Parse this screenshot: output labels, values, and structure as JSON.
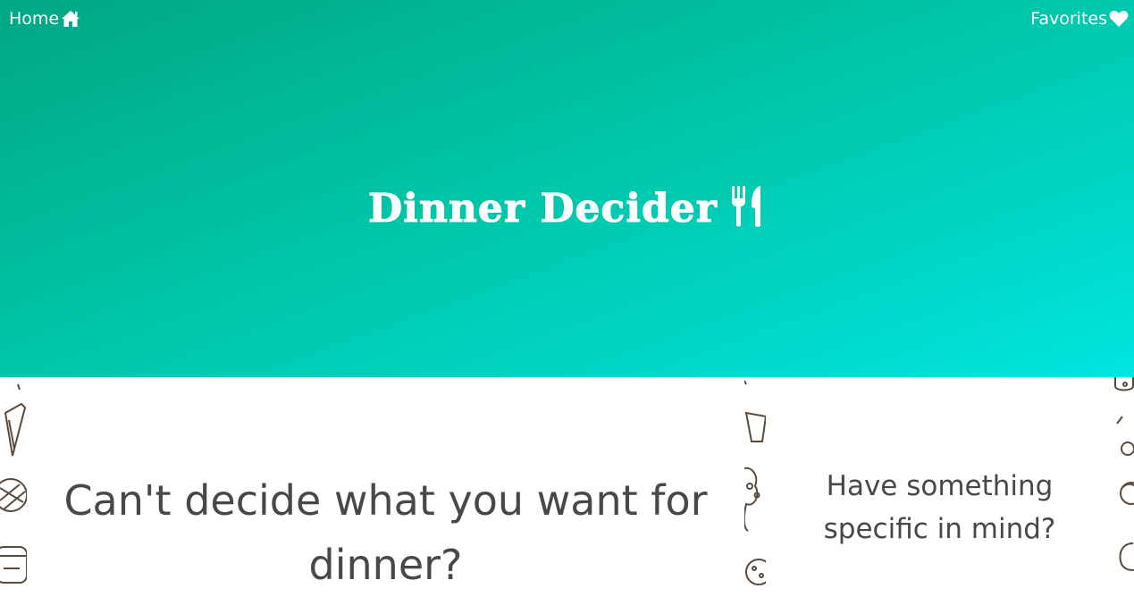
{
  "nav": {
    "home_label": "Home",
    "home_icon": "home-icon",
    "favorites_label": "Favorites",
    "favorites_icon": "heart-icon"
  },
  "hero": {
    "title": "Dinner Decider",
    "title_icon": "utensils-icon",
    "gradient_colors": [
      "#00a784",
      "#00c4a6",
      "#00e5e0"
    ]
  },
  "main_card": {
    "heading": "Can't decide what you want for dinner?"
  },
  "side_card": {
    "heading": "Have something specific in mind?"
  },
  "theme": {
    "text_color": "#484848",
    "pattern_stroke": "#5a4a3c"
  }
}
